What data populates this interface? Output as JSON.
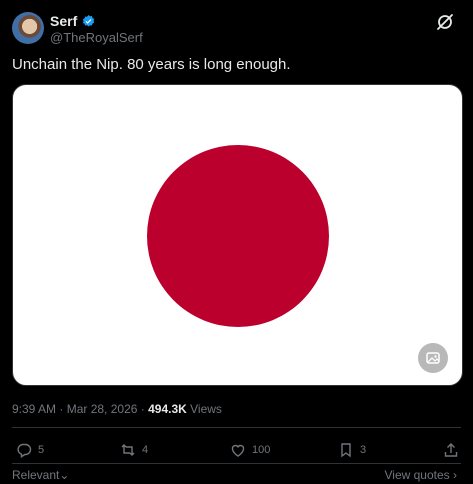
{
  "author": {
    "name": "Serf",
    "handle": "@TheRoyalSerf"
  },
  "tweet": {
    "text": "Unchain the Nip. 80 years is long enough."
  },
  "media": {
    "flag_background": "#ffffff",
    "disc_color": "#bc002d"
  },
  "meta": {
    "time": "9:39 AM",
    "separator": " · ",
    "date": "Mar 28, 2026",
    "views_count": "494.3K",
    "views_label": " Views"
  },
  "actions": {
    "replies": "5",
    "reposts": "4",
    "likes": "100",
    "bookmarks": "3"
  },
  "footer": {
    "sort_label": "Relevant",
    "view_quotes": "View quotes"
  },
  "colors": {
    "background": "#000000",
    "text": "#e7e9ea",
    "muted": "#71767b",
    "verified": "#1d9bf0"
  }
}
